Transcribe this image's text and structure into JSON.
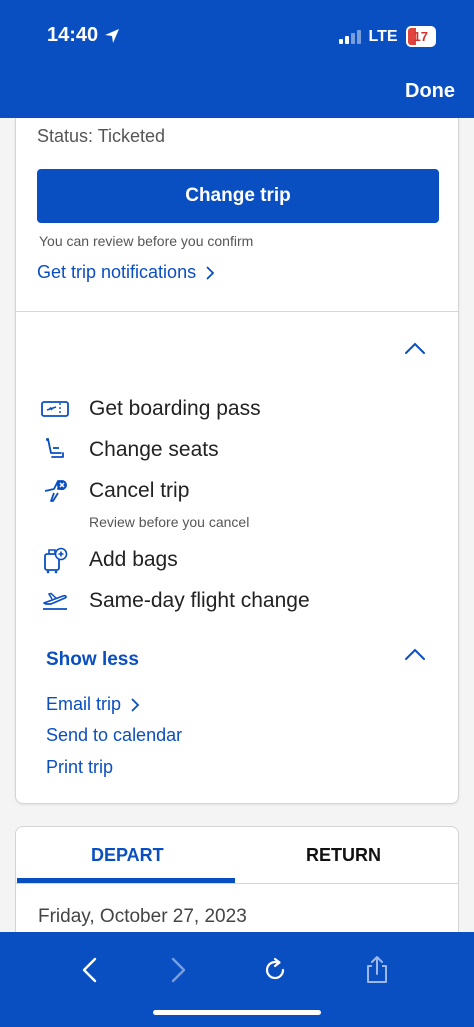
{
  "status_bar": {
    "time": "14:40",
    "network": "LTE",
    "battery": "17"
  },
  "header": {
    "done_label": "Done"
  },
  "trip": {
    "status": "Status: Ticketed",
    "change_trip_label": "Change trip",
    "review_note": "You can review before you confirm",
    "notifications_link": "Get trip notifications"
  },
  "actions": [
    {
      "label": "Get boarding pass",
      "icon": "boarding-pass-icon"
    },
    {
      "label": "Change seats",
      "icon": "seat-icon"
    },
    {
      "label": "Cancel trip",
      "icon": "cancel-flight-icon",
      "note": "Review before you cancel"
    },
    {
      "label": "Add bags",
      "icon": "add-bag-icon"
    },
    {
      "label": "Same-day flight change",
      "icon": "departure-icon"
    }
  ],
  "more": {
    "show_less_label": "Show less",
    "links": [
      "Email trip",
      "Send to calendar",
      "Print trip"
    ]
  },
  "itinerary": {
    "tabs": [
      "DEPART",
      "RETURN"
    ],
    "date": "Friday, October 27, 2023"
  },
  "colors": {
    "brand": "#0a4fc2",
    "battery_low": "#d2302c"
  }
}
